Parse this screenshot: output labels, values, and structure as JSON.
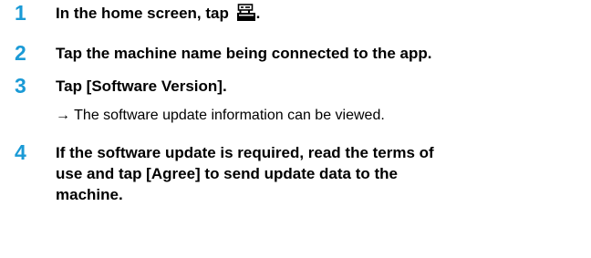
{
  "colors": {
    "step_number": "#1a9ad6",
    "text": "#000000"
  },
  "steps": [
    {
      "number": "1",
      "text_before_icon": "In the home screen, tap ",
      "icon": "machine-settings-icon",
      "text_after_icon": "."
    },
    {
      "number": "2",
      "text": "Tap the machine name being connected to the app."
    },
    {
      "number": "3",
      "text": "Tap [Software Version].",
      "result": "→ The software update information can be viewed."
    },
    {
      "number": "4",
      "lines": [
        "If the software update is required, read the terms of",
        "use and tap [Agree] to send update data to the",
        "machine."
      ]
    }
  ]
}
